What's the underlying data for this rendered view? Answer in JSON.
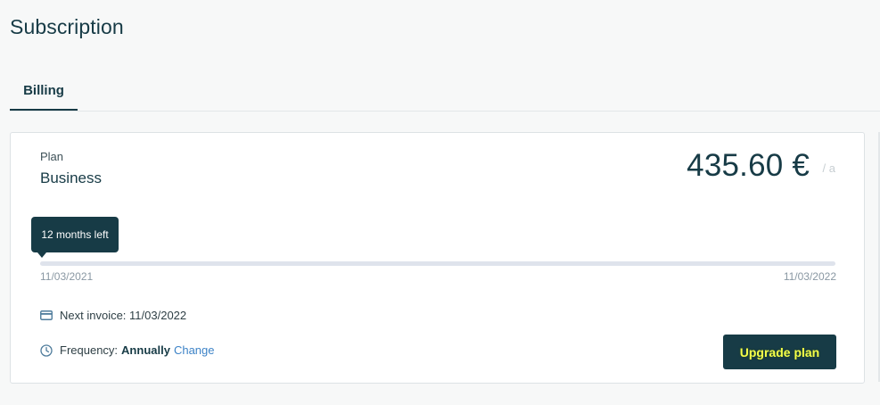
{
  "page": {
    "title": "Subscription"
  },
  "tabs": [
    {
      "label": "Billing",
      "active": true
    }
  ],
  "plan": {
    "label": "Plan",
    "name": "Business",
    "price": "435.60 €",
    "price_unit": "/ a"
  },
  "period": {
    "tooltip": "12 months left",
    "start_date": "11/03/2021",
    "end_date": "11/03/2022",
    "progress_percent": 0
  },
  "invoice": {
    "icon": "credit-card-icon",
    "text": "Next invoice: 11/03/2022"
  },
  "frequency": {
    "icon": "clock-icon",
    "label": "Frequency:",
    "value": "Annually",
    "change_label": "Change"
  },
  "actions": {
    "upgrade_label": "Upgrade plan"
  },
  "colors": {
    "primary": "#173b46",
    "link": "#3d83c7",
    "button_text": "#f4ff4a",
    "track": "#dfe3ec"
  }
}
